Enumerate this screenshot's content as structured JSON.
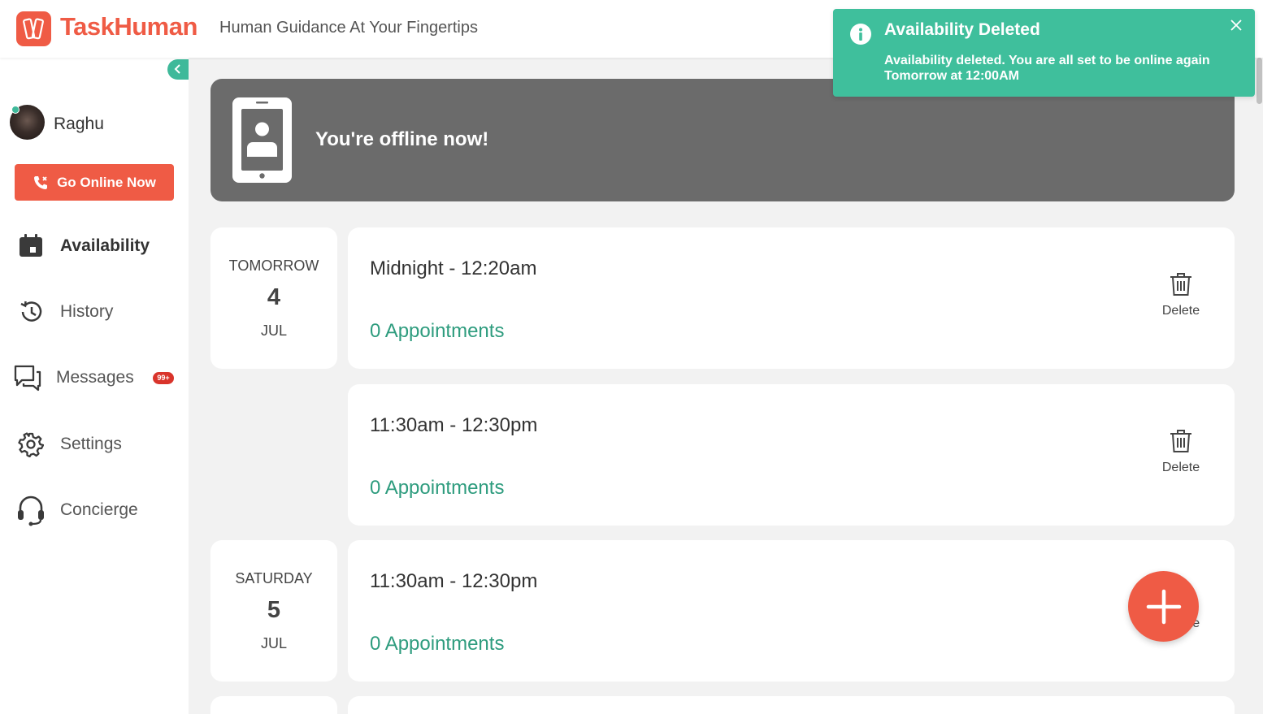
{
  "header": {
    "brand": "TaskHuman",
    "tagline": "Human Guidance At Your Fingertips"
  },
  "sidebar": {
    "collapse_icon": "chevron-left-icon",
    "user": {
      "name": "Raghu",
      "status": "online"
    },
    "go_online_label": "Go Online Now",
    "nav": [
      {
        "label": "Availability",
        "icon": "calendar-icon",
        "active": true
      },
      {
        "label": "History",
        "icon": "history-icon",
        "active": false
      },
      {
        "label": "Messages",
        "icon": "messages-icon",
        "badge": "99+",
        "active": false
      },
      {
        "label": "Settings",
        "icon": "gear-icon",
        "active": false
      },
      {
        "label": "Concierge",
        "icon": "headset-icon",
        "active": false
      }
    ]
  },
  "banner": {
    "text": "You're offline now!"
  },
  "schedule": {
    "days": [
      {
        "day": "TOMORROW",
        "date": "4",
        "month": "JUL"
      },
      {
        "day": "SATURDAY",
        "date": "5",
        "month": "JUL"
      }
    ],
    "slots": [
      {
        "time": "Midnight - 12:20am",
        "appointments": "0 Appointments",
        "delete_label": "Delete"
      },
      {
        "time": "11:30am - 12:30pm",
        "appointments": "0 Appointments",
        "delete_label": "Delete"
      },
      {
        "time": "11:30am - 12:30pm",
        "appointments": "0 Appointments",
        "delete_label": "Delete"
      }
    ]
  },
  "toast": {
    "title": "Availability Deleted",
    "message": "Availability deleted. You are all set to be online again Tomorrow at 12:00AM",
    "close_icon": "close-icon"
  },
  "colors": {
    "brand": "#ef5b45",
    "accent": "#3fb99a",
    "appointments": "#2e9c7e",
    "banner": "#6b6b6b"
  }
}
